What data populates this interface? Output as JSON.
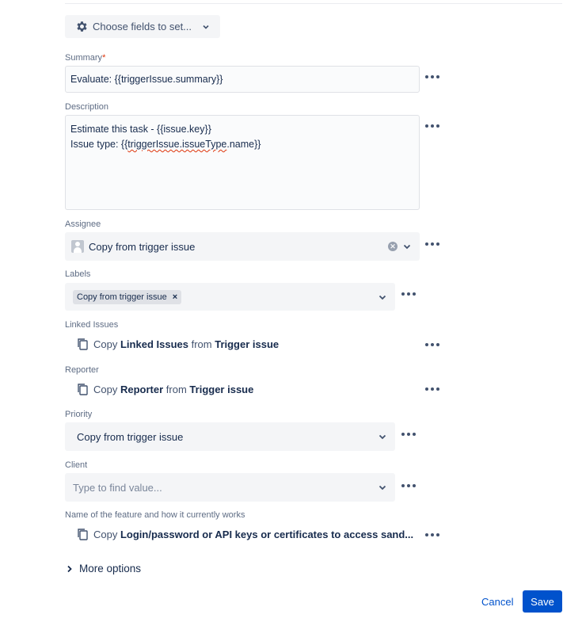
{
  "toolbar": {
    "choose_fields_label": "Choose fields to set..."
  },
  "summary": {
    "label": "Summary",
    "required_mark": "*",
    "value": "Evaluate: {{triggerIssue.summary}}"
  },
  "description": {
    "label": "Description",
    "line1": "Estimate this task - {{issue.key}}",
    "line2_prefix": "Issue type: {{",
    "line2_misspelled": "triggerIssue.issueType",
    "line2_suffix": ".name}}"
  },
  "assignee": {
    "label": "Assignee",
    "value": "Copy from trigger issue"
  },
  "labels": {
    "label": "Labels",
    "chip": "Copy from trigger issue",
    "chip_remove": "×"
  },
  "linked_issues": {
    "label": "Linked Issues",
    "prefix": "Copy",
    "field": "Linked Issues",
    "mid": "from",
    "source": "Trigger issue"
  },
  "reporter": {
    "label": "Reporter",
    "prefix": "Copy",
    "field": "Reporter",
    "mid": "from",
    "source": "Trigger issue"
  },
  "priority": {
    "label": "Priority",
    "value": "Copy from trigger issue"
  },
  "client": {
    "label": "Client",
    "placeholder": "Type to find value..."
  },
  "feature": {
    "label": "Name of the feature and how it currently works",
    "prefix": "Copy",
    "field": "Login/password or API keys or certificates to access sand..."
  },
  "more_options": "More options",
  "footer": {
    "cancel": "Cancel",
    "save": "Save"
  },
  "colors": {
    "primary": "#0052cc",
    "required": "#de350b",
    "field_bg": "#f4f5f7",
    "text": "#172b4d"
  }
}
